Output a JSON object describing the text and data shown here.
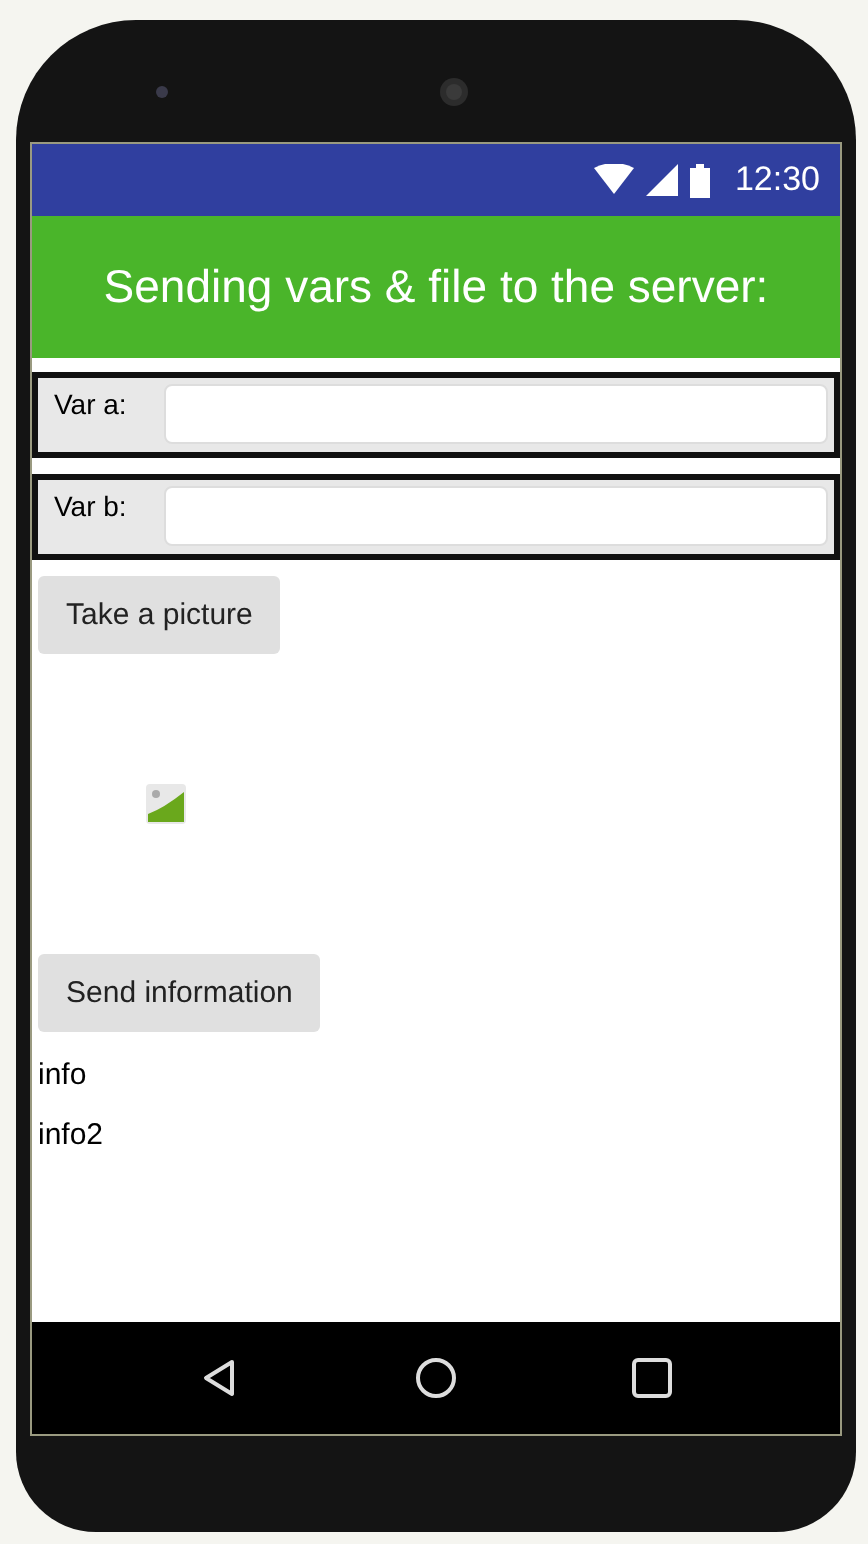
{
  "status_bar": {
    "time": "12:30"
  },
  "title": "Sending vars & file to the server:",
  "fields": [
    {
      "label": "Var a:"
    },
    {
      "label": "Var b:"
    }
  ],
  "picture_button": {
    "label": "Take a picture"
  },
  "send_button": {
    "label": "Send information"
  },
  "labels": [
    "info",
    "info2"
  ]
}
